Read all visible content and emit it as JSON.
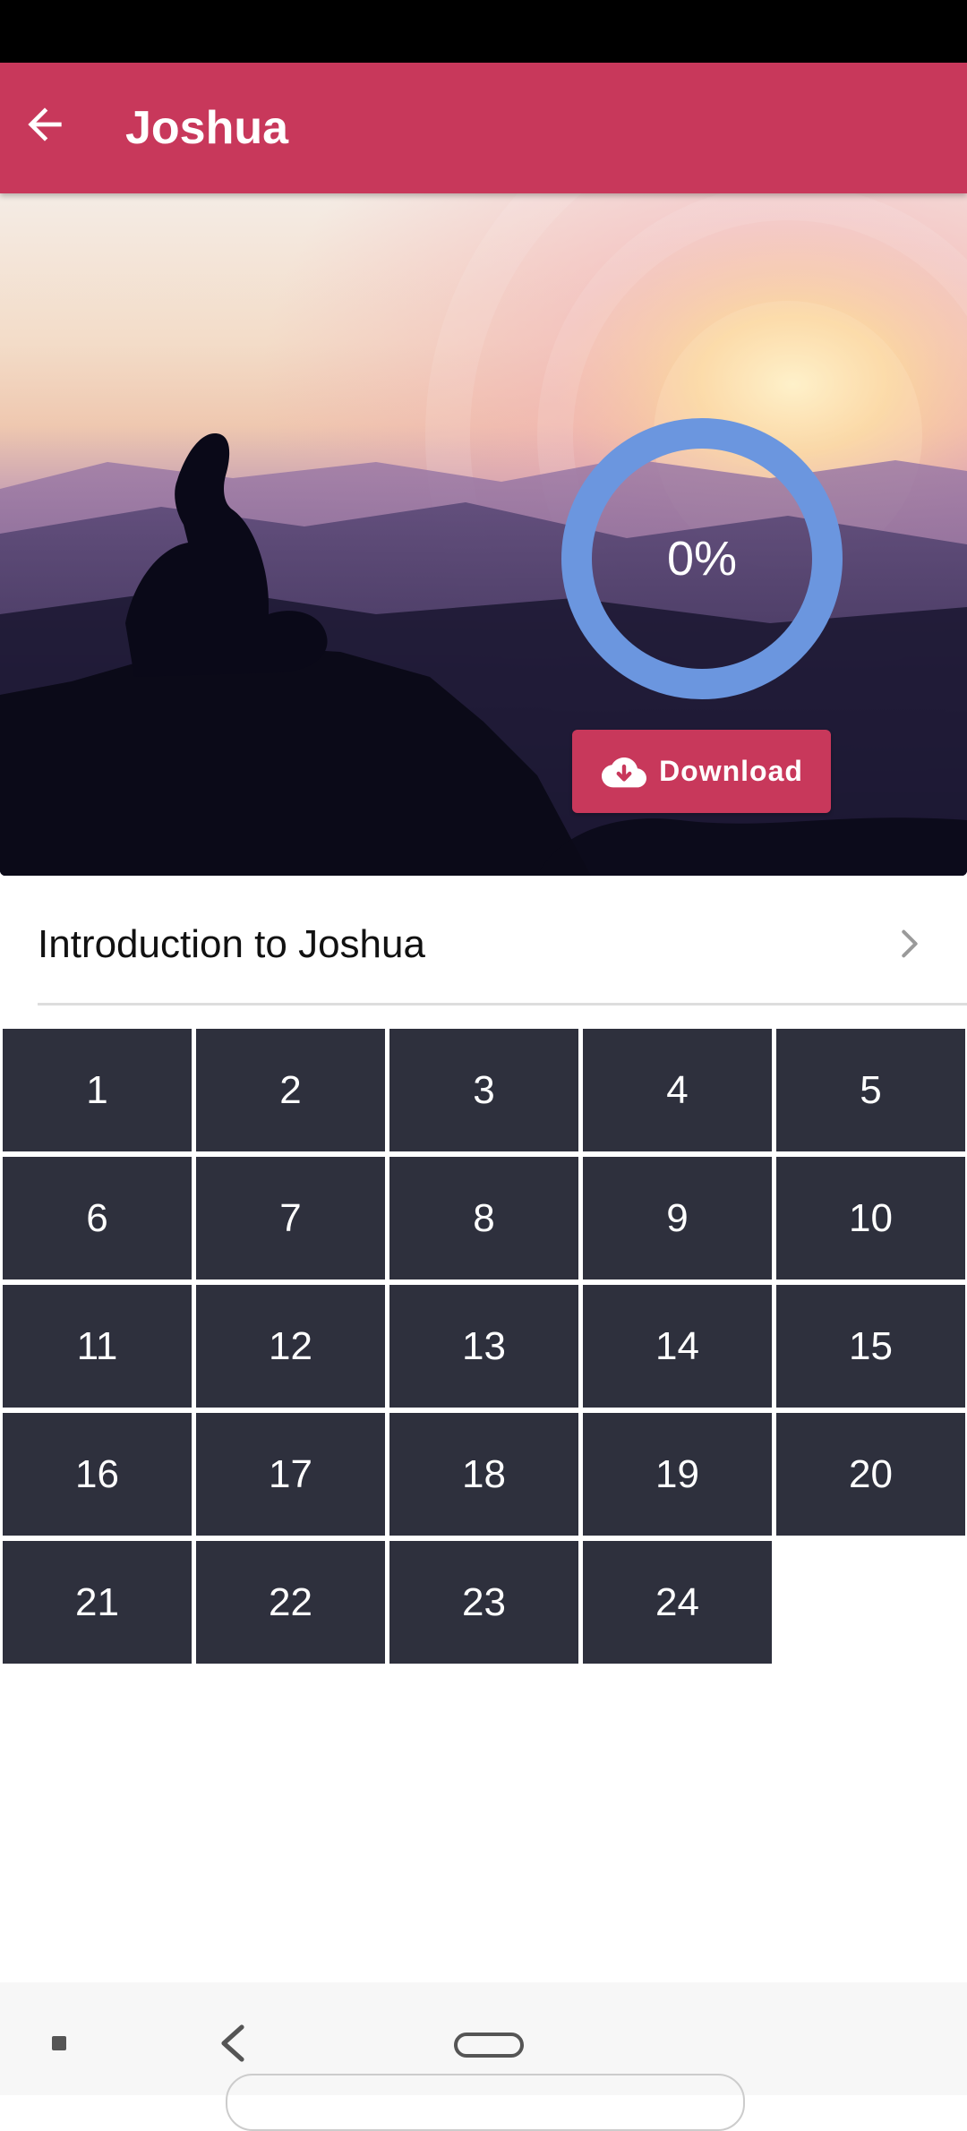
{
  "app_bar": {
    "title": "Joshua",
    "back_icon": "arrow-left-icon",
    "color": "#c8385b"
  },
  "hero": {
    "progress_text": "0%",
    "progress_value": 0,
    "ring_color": "#6b96df",
    "download_label": "Download",
    "download_icon": "cloud-download-icon"
  },
  "intro": {
    "label": "Introduction to Joshua",
    "icon": "chevron-right-icon"
  },
  "chapters": {
    "c1": "1",
    "c2": "2",
    "c3": "3",
    "c4": "4",
    "c5": "5",
    "c6": "6",
    "c7": "7",
    "c8": "8",
    "c9": "9",
    "c10": "10",
    "c11": "11",
    "c12": "12",
    "c13": "13",
    "c14": "14",
    "c15": "15",
    "c16": "16",
    "c17": "17",
    "c18": "18",
    "c19": "19",
    "c20": "20",
    "c21": "21",
    "c22": "22",
    "c23": "23",
    "c24": "24",
    "cell_color": "#2e303d"
  },
  "nav_bar": {
    "recents_icon": "square-icon",
    "back_icon": "chevron-left-icon",
    "home_icon": "home-pill-icon"
  }
}
